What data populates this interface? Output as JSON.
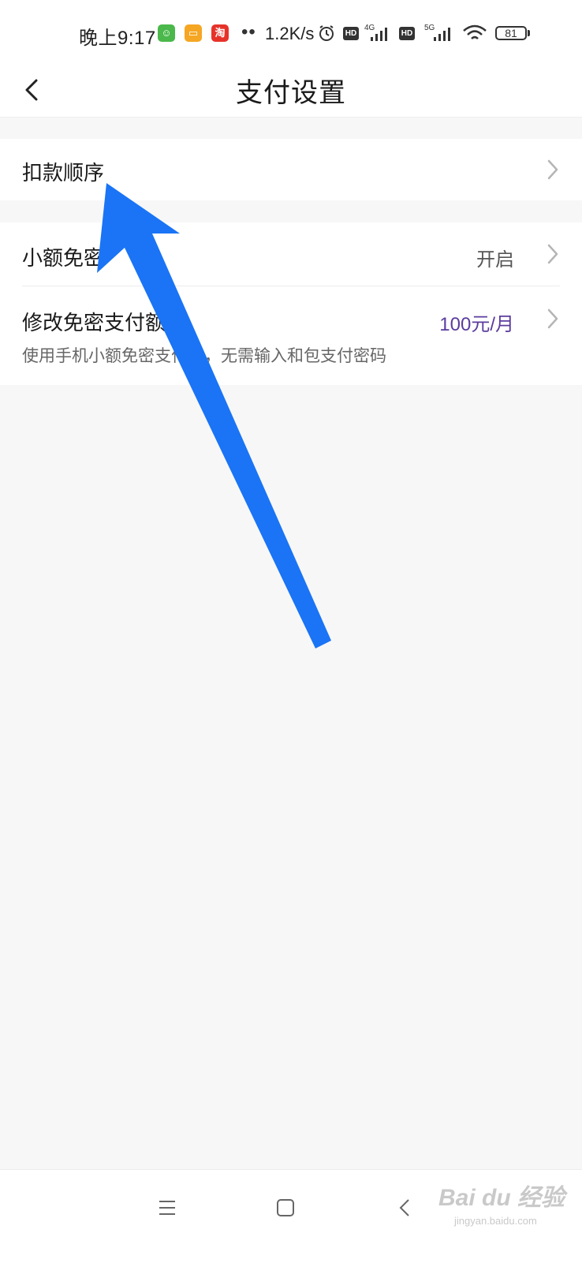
{
  "status_bar": {
    "time": "晚上9:17",
    "net_speed": "1.2K/s",
    "hd1": "HD",
    "hd2": "HD",
    "net1": "4G",
    "net2": "5G",
    "battery": "81",
    "app_icons": [
      "wechat-mini-icon",
      "message-icon",
      "taobao-icon"
    ],
    "taobao_char": "淘"
  },
  "header": {
    "title": "支付设置"
  },
  "sections": {
    "deduction_order": {
      "label": "扣款顺序"
    },
    "small_free": {
      "label": "小额免密",
      "value": "开启"
    },
    "modify_limit": {
      "label": "修改免密支付额度",
      "value": "100元/月",
      "description": "使用手机小额免密支付时，无需输入和包支付密码"
    }
  },
  "colors": {
    "accent_value": "#5b3c9e",
    "arrow": "#1a74f5",
    "background": "#f7f7f7"
  },
  "watermark": {
    "brand": "Bai du 经验",
    "url": "jingyan.baidu.com"
  }
}
